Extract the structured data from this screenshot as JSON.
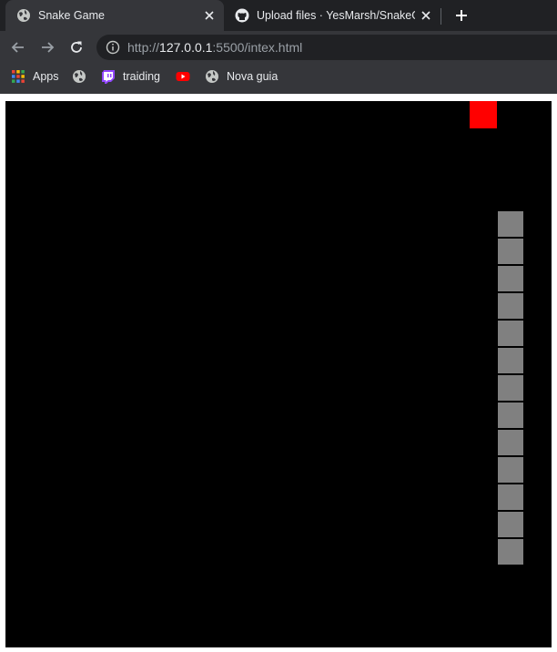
{
  "browser": {
    "tabs": [
      {
        "title": "Snake Game",
        "active": true,
        "favicon": "globe-icon"
      },
      {
        "title": "Upload files · YesMarsh/SnakeGame",
        "active": false,
        "favicon": "github-icon"
      }
    ],
    "address_bar": {
      "url_scheme": "http://",
      "url_host": "127.0.0.1",
      "url_rest": ":5500/intex.html"
    },
    "bookmarks": [
      {
        "label": "Apps",
        "icon": "apps-grid-icon"
      },
      {
        "label": "",
        "icon": "globe-icon"
      },
      {
        "label": "traiding",
        "icon": "twitch-icon"
      },
      {
        "label": "",
        "icon": "youtube-icon"
      },
      {
        "label": "Nova guia",
        "icon": "globe-icon"
      }
    ]
  },
  "game": {
    "grid_cols": 20,
    "grid_rows": 20,
    "board_color": "#000000",
    "snake_color": "#808080",
    "food_color": "#ff0000",
    "food": {
      "col": 17,
      "row": 0
    },
    "snake": [
      {
        "col": 18,
        "row": 4
      },
      {
        "col": 18,
        "row": 5
      },
      {
        "col": 18,
        "row": 6
      },
      {
        "col": 18,
        "row": 7
      },
      {
        "col": 18,
        "row": 8
      },
      {
        "col": 18,
        "row": 9
      },
      {
        "col": 18,
        "row": 10
      },
      {
        "col": 18,
        "row": 11
      },
      {
        "col": 18,
        "row": 12
      },
      {
        "col": 18,
        "row": 13
      },
      {
        "col": 18,
        "row": 14
      },
      {
        "col": 18,
        "row": 15
      },
      {
        "col": 18,
        "row": 16
      }
    ]
  }
}
